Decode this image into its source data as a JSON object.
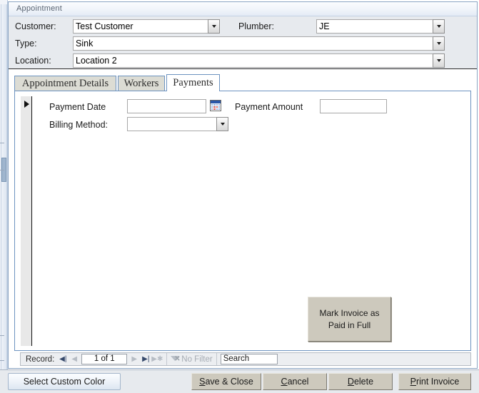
{
  "window": {
    "title": "Appointment"
  },
  "header": {
    "customer": {
      "label": "Customer:",
      "value": "Test Customer",
      "dropdown_icon": "chevron-down-icon"
    },
    "plumber": {
      "label": "Plumber:",
      "value": "JE",
      "dropdown_icon": "chevron-down-icon"
    },
    "type": {
      "label": "Type:",
      "value": "Sink",
      "dropdown_icon": "chevron-down-icon"
    },
    "location": {
      "label": "Location:",
      "value": "Location 2",
      "dropdown_icon": "chevron-down-icon"
    }
  },
  "tabs": [
    {
      "label": "Appointment Details",
      "selected": false
    },
    {
      "label": "Workers",
      "selected": false
    },
    {
      "label": "Payments",
      "selected": true
    }
  ],
  "payments_tab": {
    "record_selector_icon": "record-arrow-icon",
    "payment_date": {
      "label": "Payment Date",
      "value": "",
      "placeholder": "",
      "picker_icon": "calendar-icon"
    },
    "payment_amount": {
      "label": "Payment Amount",
      "value": "",
      "placeholder": ""
    },
    "billing_method": {
      "label": "Billing Method:",
      "value": "",
      "dropdown_icon": "chevron-down-icon"
    },
    "mark_paid_button": {
      "line1": "Mark Invoice as",
      "line2": "Paid in Full"
    }
  },
  "record_nav": {
    "label": "Record:",
    "first_icon": "first-record-icon",
    "first_glyph": "◀|",
    "prev_icon": "previous-record-icon",
    "prev_glyph": "◀",
    "position": "1 of 1",
    "next_icon": "next-record-icon",
    "next_glyph": "▶",
    "last_icon": "last-record-icon",
    "last_glyph": "▶|",
    "new_icon": "new-record-icon",
    "new_glyph": "▶✱",
    "filter_icon": "filter-icon",
    "filter_label": "No Filter",
    "search_placeholder": "Search",
    "search_value": "Search"
  },
  "command_bar": {
    "custom_color": "Select Custom Color",
    "save_close": {
      "accel": "S",
      "rest": "ave & Close"
    },
    "cancel": {
      "accel": "C",
      "rest": "ancel"
    },
    "delete": {
      "accel": "D",
      "rest": "elete"
    },
    "print_invoice": {
      "accel": "P",
      "rest": "rint Invoice"
    }
  },
  "colors": {
    "header_bg": "#e7eaee",
    "tab_selected_bg": "#ffffff",
    "tab_border": "#6d93c0",
    "button_face": "#cdc9bd",
    "window_border": "#8ba5c4"
  }
}
